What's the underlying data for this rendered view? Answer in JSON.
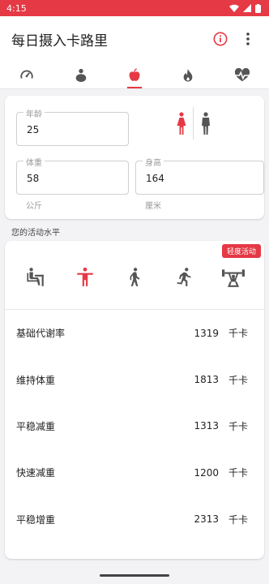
{
  "status": {
    "time": "4:15"
  },
  "app": {
    "title": "每日摄入卡路里"
  },
  "tabs": [
    {
      "icon": "speedometer-icon"
    },
    {
      "icon": "body-icon"
    },
    {
      "icon": "apple-icon",
      "active": true
    },
    {
      "icon": "flame-icon"
    },
    {
      "icon": "heartbeat-icon"
    }
  ],
  "profile": {
    "age_label": "年龄",
    "age_value": "25",
    "weight_label": "体重",
    "weight_value": "58",
    "weight_unit": "公斤",
    "height_label": "身高",
    "height_value": "164",
    "height_unit": "厘米",
    "gender_selected": "female"
  },
  "activity": {
    "section_label": "您的活动水平",
    "badge": "轻度活动",
    "selected_index": 1
  },
  "results": [
    {
      "label": "基础代谢率",
      "value": "1319",
      "unit": "千卡"
    },
    {
      "label": "维持体重",
      "value": "1813",
      "unit": "千卡"
    },
    {
      "label": "平稳减重",
      "value": "1313",
      "unit": "千卡"
    },
    {
      "label": "快速减重",
      "value": "1200",
      "unit": "千卡"
    },
    {
      "label": "平稳增重",
      "value": "2313",
      "unit": "千卡"
    }
  ],
  "colors": {
    "accent": "#e53945",
    "icon_gray": "#555555"
  }
}
